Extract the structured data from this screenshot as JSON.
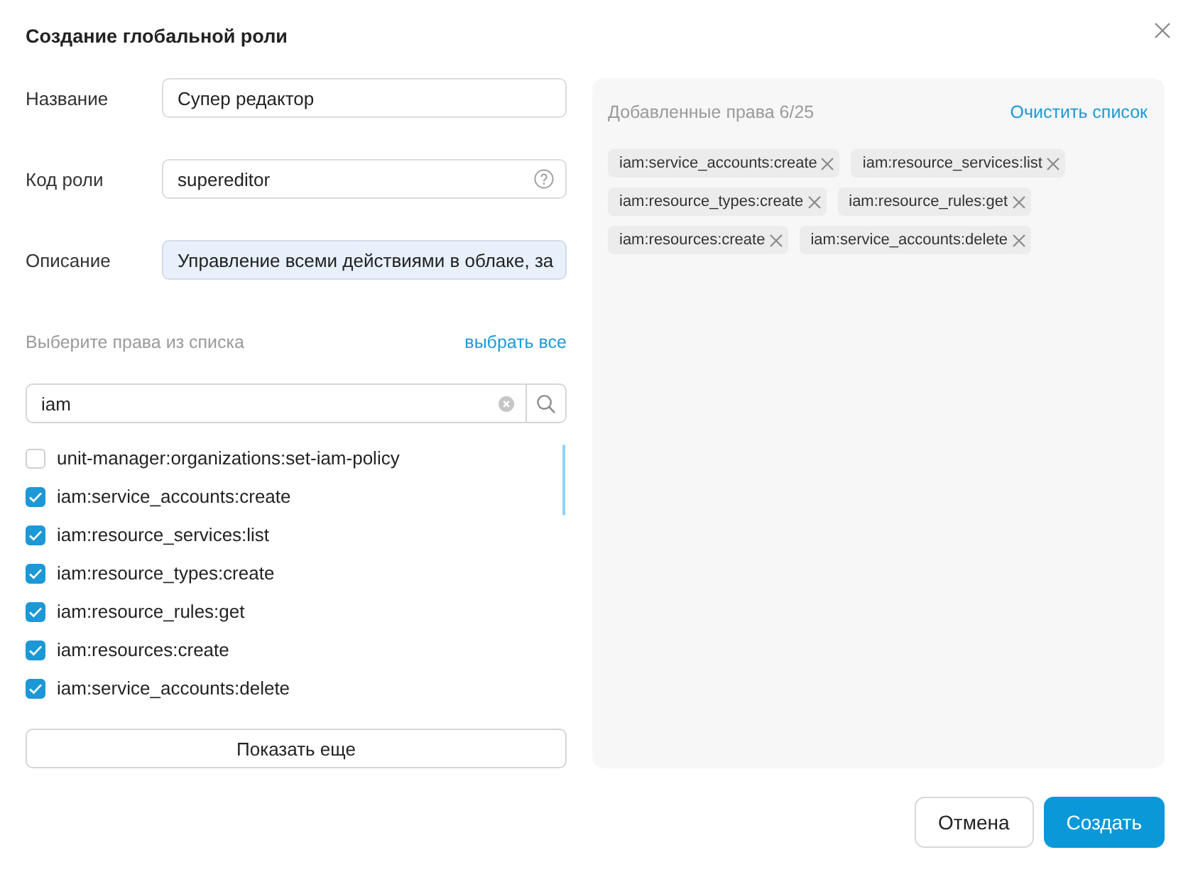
{
  "dialog": {
    "title": "Создание глобальной роли"
  },
  "fields": [
    {
      "label": "Название",
      "value": "Супер редактор",
      "kind": "text",
      "highlighted": false
    },
    {
      "label": "Код роли",
      "value": "supereditor",
      "kind": "help",
      "highlighted": false
    },
    {
      "label": "Описание",
      "value": "Управление всеми действиями в облаке, за",
      "kind": "text",
      "highlighted": true
    }
  ],
  "permissions": {
    "hint": "Выберите права из списка",
    "select_all": "выбрать все",
    "search": {
      "value": "iam"
    },
    "items": [
      {
        "label": "unit-manager:organizations:set-iam-policy",
        "checked": false
      },
      {
        "label": "iam:service_accounts:create",
        "checked": true
      },
      {
        "label": "iam:resource_services:list",
        "checked": true
      },
      {
        "label": "iam:resource_types:create",
        "checked": true
      },
      {
        "label": "iam:resource_rules:get",
        "checked": true
      },
      {
        "label": "iam:resources:create",
        "checked": true
      },
      {
        "label": "iam:service_accounts:delete",
        "checked": true
      }
    ],
    "show_more": "Показать еще"
  },
  "added": {
    "title": "Добавленные права 6/25",
    "clear": "Очистить список",
    "tags": [
      {
        "label": "iam:service_accounts:create"
      },
      {
        "label": "iam:resource_services:list"
      },
      {
        "label": "iam:resource_types:create"
      },
      {
        "label": "iam:resource_rules:get"
      },
      {
        "label": "iam:resources:create"
      },
      {
        "label": "iam:service_accounts:delete"
      }
    ]
  },
  "buttons": [
    {
      "label": "Отмена",
      "kind": "secondary"
    },
    {
      "label": "Создать",
      "kind": "primary"
    }
  ]
}
